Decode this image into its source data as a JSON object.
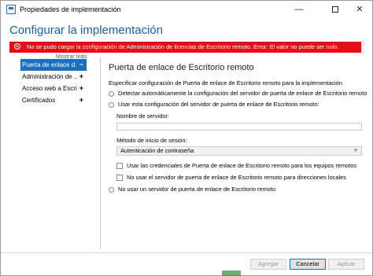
{
  "window": {
    "title": "Propiedades de implementación"
  },
  "heading": "Configurar la implementación",
  "error": {
    "icon": "error-icon",
    "message": "No se pudo cargar la configuración de Administración de licencias de Escritorio remoto. Error: El valor no puede ser nulo.",
    "color": "#e50e16"
  },
  "sidebar": {
    "show_all": "Mostrar todo",
    "items": [
      {
        "label": "Puerta de enlace d...",
        "sign": "−",
        "active": true
      },
      {
        "label": "Administración de ...",
        "sign": "+"
      },
      {
        "label": "Acceso web a Escri...",
        "sign": "+"
      },
      {
        "label": "Certificados",
        "sign": "+"
      }
    ]
  },
  "main": {
    "section_title": "Puerta de enlace de Escritorio remoto",
    "description": "Especificar configuración de Puerta de enlace de Escritorio remoto para la implementación",
    "radio_auto": "Detectar automáticamente la configuración del servidor de puerta de enlace de Escritorio remoto",
    "radio_use": "Usar esta configuración del servidor de puerta de enlace de Escritorio remoto:",
    "server_name_label": "Nombre de servidor:",
    "server_name_value": "",
    "login_method_label": "Método de inicio de sesión:",
    "login_method_value": "Autenticación de contraseña",
    "check_credentials": "Usar las credenciales de Puerta de enlace de Escritorio remoto para los equipos remotos",
    "check_bypass": "No usar el servidor de puerta de enlace de Escritorio remoto para direcciones locales",
    "radio_none": "No usar un servidor de puerta de enlace de Escritorio remoto"
  },
  "footer": {
    "add_label": "Agregar",
    "cancel_label": "Cancelar",
    "apply_label": "Aplicar"
  },
  "colors": {
    "accent": "#1a6fc0",
    "heading": "#1b5fa3"
  }
}
